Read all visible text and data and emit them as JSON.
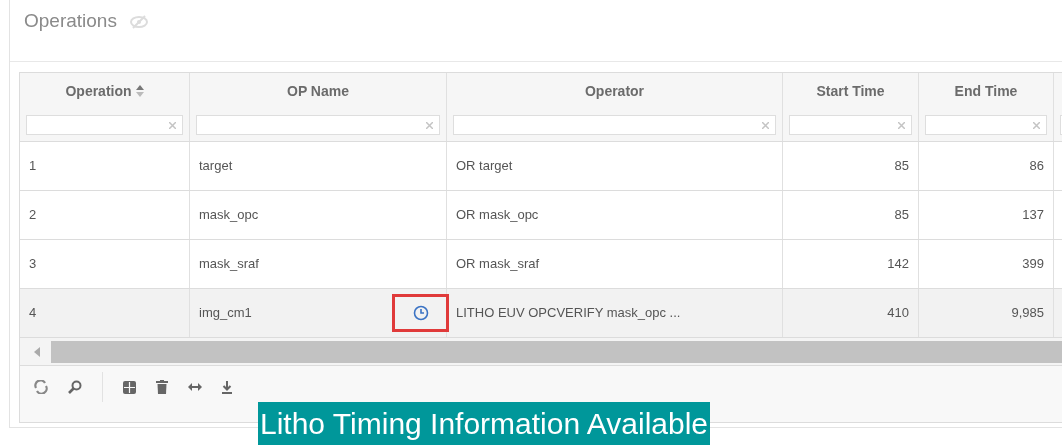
{
  "panel": {
    "title": "Operations"
  },
  "table": {
    "columns": [
      {
        "label": "Operation",
        "sort_icon": true,
        "kind": "text"
      },
      {
        "label": "OP Name",
        "sort_icon": false,
        "kind": "text"
      },
      {
        "label": "Operator",
        "sort_icon": false,
        "kind": "text"
      },
      {
        "label": "Start Time",
        "sort_icon": false,
        "kind": "number"
      },
      {
        "label": "End Time",
        "sort_icon": false,
        "kind": "number"
      }
    ],
    "rows": [
      {
        "cells": [
          "1",
          "target",
          "OR target",
          "85",
          "86"
        ],
        "selected": false,
        "timing_icon": false
      },
      {
        "cells": [
          "2",
          "mask_opc",
          "OR mask_opc",
          "85",
          "137"
        ],
        "selected": false,
        "timing_icon": false
      },
      {
        "cells": [
          "3",
          "mask_sraf",
          "OR mask_sraf",
          "142",
          "399"
        ],
        "selected": false,
        "timing_icon": false
      },
      {
        "cells": [
          "4",
          "img_cm1",
          "LITHO EUV OPCVERIFY mask_opc ...",
          "410",
          "9,985"
        ],
        "selected": true,
        "timing_icon": true
      }
    ]
  },
  "toolbar": [
    {
      "kind": "refresh"
    },
    {
      "kind": "search"
    },
    {
      "kind": "columns"
    },
    {
      "kind": "delete"
    },
    {
      "kind": "resize"
    },
    {
      "kind": "export"
    }
  ],
  "caption": "Litho Timing Information Available"
}
